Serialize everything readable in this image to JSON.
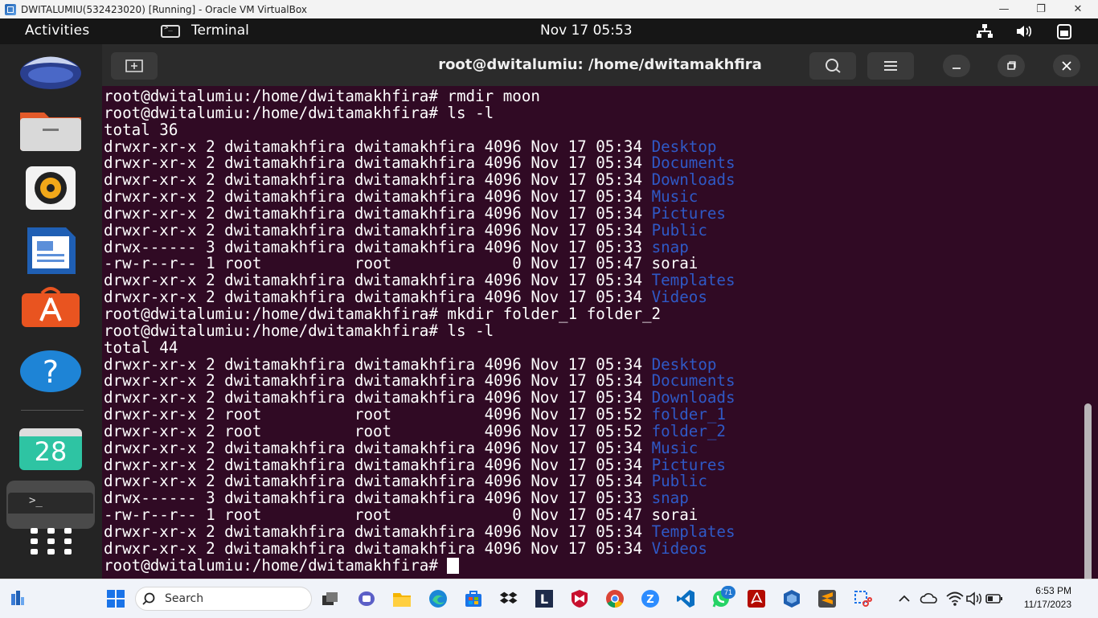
{
  "vbox": {
    "title": "DWITALUMIU(532423020) [Running] - Oracle VM VirtualBox"
  },
  "topbar": {
    "activities": "Activities",
    "app_name": "Terminal",
    "clock": "Nov 17  05:53"
  },
  "dock": {
    "calendar_day": "28"
  },
  "terminal": {
    "title": "root@dwitalumiu: /home/dwitamakhfira",
    "lines": [
      [
        {
          "t": "root@dwitalumiu:/home/dwitamakhfira# rmdir moon"
        }
      ],
      [
        {
          "t": "root@dwitalumiu:/home/dwitamakhfira# ls -l"
        }
      ],
      [
        {
          "t": "total 36"
        }
      ],
      [
        {
          "t": "drwxr-xr-x 2 dwitamakhfira dwitamakhfira 4096 Nov 17 05:34 "
        },
        {
          "t": "Desktop",
          "dir": true
        }
      ],
      [
        {
          "t": "drwxr-xr-x 2 dwitamakhfira dwitamakhfira 4096 Nov 17 05:34 "
        },
        {
          "t": "Documents",
          "dir": true
        }
      ],
      [
        {
          "t": "drwxr-xr-x 2 dwitamakhfira dwitamakhfira 4096 Nov 17 05:34 "
        },
        {
          "t": "Downloads",
          "dir": true
        }
      ],
      [
        {
          "t": "drwxr-xr-x 2 dwitamakhfira dwitamakhfira 4096 Nov 17 05:34 "
        },
        {
          "t": "Music",
          "dir": true
        }
      ],
      [
        {
          "t": "drwxr-xr-x 2 dwitamakhfira dwitamakhfira 4096 Nov 17 05:34 "
        },
        {
          "t": "Pictures",
          "dir": true
        }
      ],
      [
        {
          "t": "drwxr-xr-x 2 dwitamakhfira dwitamakhfira 4096 Nov 17 05:34 "
        },
        {
          "t": "Public",
          "dir": true
        }
      ],
      [
        {
          "t": "drwx------ 3 dwitamakhfira dwitamakhfira 4096 Nov 17 05:33 "
        },
        {
          "t": "snap",
          "dir": true
        }
      ],
      [
        {
          "t": "-rw-r--r-- 1 root          root             0 Nov 17 05:47 sorai"
        }
      ],
      [
        {
          "t": "drwxr-xr-x 2 dwitamakhfira dwitamakhfira 4096 Nov 17 05:34 "
        },
        {
          "t": "Templates",
          "dir": true
        }
      ],
      [
        {
          "t": "drwxr-xr-x 2 dwitamakhfira dwitamakhfira 4096 Nov 17 05:34 "
        },
        {
          "t": "Videos",
          "dir": true
        }
      ],
      [
        {
          "t": "root@dwitalumiu:/home/dwitamakhfira# mkdir folder_1 folder_2"
        }
      ],
      [
        {
          "t": "root@dwitalumiu:/home/dwitamakhfira# ls -l"
        }
      ],
      [
        {
          "t": "total 44"
        }
      ],
      [
        {
          "t": "drwxr-xr-x 2 dwitamakhfira dwitamakhfira 4096 Nov 17 05:34 "
        },
        {
          "t": "Desktop",
          "dir": true
        }
      ],
      [
        {
          "t": "drwxr-xr-x 2 dwitamakhfira dwitamakhfira 4096 Nov 17 05:34 "
        },
        {
          "t": "Documents",
          "dir": true
        }
      ],
      [
        {
          "t": "drwxr-xr-x 2 dwitamakhfira dwitamakhfira 4096 Nov 17 05:34 "
        },
        {
          "t": "Downloads",
          "dir": true
        }
      ],
      [
        {
          "t": "drwxr-xr-x 2 root          root          4096 Nov 17 05:52 "
        },
        {
          "t": "folder_1",
          "dir": true
        }
      ],
      [
        {
          "t": "drwxr-xr-x 2 root          root          4096 Nov 17 05:52 "
        },
        {
          "t": "folder_2",
          "dir": true
        }
      ],
      [
        {
          "t": "drwxr-xr-x 2 dwitamakhfira dwitamakhfira 4096 Nov 17 05:34 "
        },
        {
          "t": "Music",
          "dir": true
        }
      ],
      [
        {
          "t": "drwxr-xr-x 2 dwitamakhfira dwitamakhfira 4096 Nov 17 05:34 "
        },
        {
          "t": "Pictures",
          "dir": true
        }
      ],
      [
        {
          "t": "drwxr-xr-x 2 dwitamakhfira dwitamakhfira 4096 Nov 17 05:34 "
        },
        {
          "t": "Public",
          "dir": true
        }
      ],
      [
        {
          "t": "drwx------ 3 dwitamakhfira dwitamakhfira 4096 Nov 17 05:33 "
        },
        {
          "t": "snap",
          "dir": true
        }
      ],
      [
        {
          "t": "-rw-r--r-- 1 root          root             0 Nov 17 05:47 sorai"
        }
      ],
      [
        {
          "t": "drwxr-xr-x 2 dwitamakhfira dwitamakhfira 4096 Nov 17 05:34 "
        },
        {
          "t": "Templates",
          "dir": true
        }
      ],
      [
        {
          "t": "drwxr-xr-x 2 dwitamakhfira dwitamakhfira 4096 Nov 17 05:34 "
        },
        {
          "t": "Videos",
          "dir": true
        }
      ],
      [
        {
          "t": "root@dwitalumiu:/home/dwitamakhfira# "
        }
      ]
    ]
  },
  "taskbar": {
    "search_label": "Search",
    "time": "6:53 PM",
    "date": "11/17/2023",
    "whatsapp_badge": "71"
  },
  "colors": {
    "terminal_bg": "#300a24",
    "directory": "#2f59c6",
    "accent": "#e95420"
  }
}
